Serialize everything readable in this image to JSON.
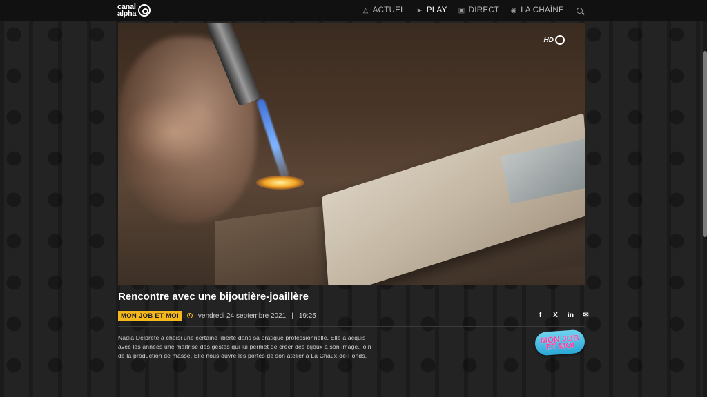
{
  "header": {
    "logo_line1": "canal",
    "logo_line2": "alpha",
    "nav": [
      {
        "label": "ACTUEL",
        "icon": "flame-icon"
      },
      {
        "label": "PLAY",
        "icon": "play-icon"
      },
      {
        "label": "DIRECT",
        "icon": "tv-icon"
      },
      {
        "label": "LA CHAÎNE",
        "icon": "globe-icon"
      }
    ],
    "search_icon": "search-icon"
  },
  "player": {
    "badge": "HD"
  },
  "article": {
    "title": "Rencontre avec une bijoutière-joaillère",
    "category": "MON JOB ET MOI",
    "date": "vendredi 24 septembre 2021",
    "separator": "|",
    "time": "19:25",
    "description": "Nadia Delprete a choisi une certaine liberté dans sa pratique professionnelle. Elle a acquis avec les années une maîtrise des gestes qui lui permet de créer des bijoux à son image, loin de la production de masse. Elle nous ouvre les portes de son atelier à La Chaux-de-Fonds.",
    "share": [
      {
        "icon": "facebook-icon",
        "glyph": "f"
      },
      {
        "icon": "x-icon",
        "glyph": "X"
      },
      {
        "icon": "linkedin-icon",
        "glyph": "in"
      },
      {
        "icon": "mail-icon",
        "glyph": "✉"
      }
    ],
    "show_logo_text": "MON JOB ET MOI"
  },
  "colors": {
    "accent": "#f5b81c",
    "header_bg": "#111111",
    "page_bg": "#232323"
  }
}
